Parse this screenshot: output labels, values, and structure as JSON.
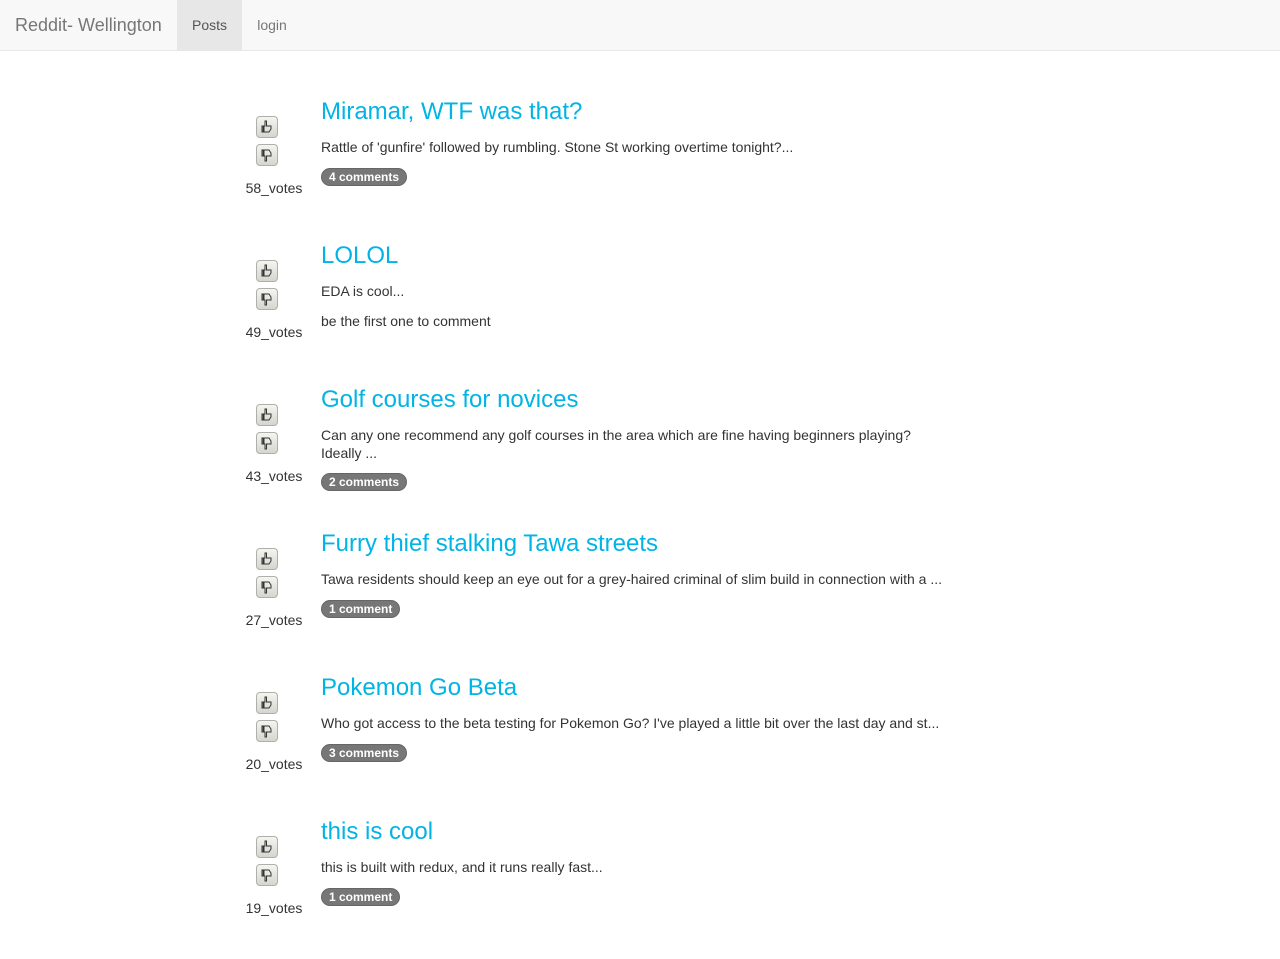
{
  "nav": {
    "brand": "Reddit- Wellington",
    "items": [
      {
        "label": "Posts",
        "active": true
      },
      {
        "label": "login",
        "active": false
      }
    ]
  },
  "icons": {
    "upvote": "thumbs-up-icon",
    "downvote": "thumbs-down-icon"
  },
  "colors": {
    "title_link": "#00b4e4",
    "badge": "#777777",
    "navbar_bg": "#f8f8f8"
  },
  "posts": [
    {
      "title": "Miramar, WTF was that?",
      "body": "Rattle of 'gunfire' followed by rumbling. Stone St working overtime tonight?...",
      "votes": "58_votes",
      "comments": "4 comments",
      "has_comments": true
    },
    {
      "title": "LOLOL",
      "body": "EDA is cool...",
      "votes": "49_votes",
      "comments": "be the first one to comment",
      "has_comments": false
    },
    {
      "title": "Golf courses for novices",
      "body": "Can any one recommend any golf courses in the area which are fine having beginners playing? Ideally ...",
      "votes": "43_votes",
      "comments": "2 comments",
      "has_comments": true
    },
    {
      "title": "Furry thief stalking Tawa streets",
      "body": "Tawa residents should keep an eye out for a grey-haired criminal of slim build in connection with a ...",
      "votes": "27_votes",
      "comments": "1 comment",
      "has_comments": true
    },
    {
      "title": "Pokemon Go Beta",
      "body": "Who got access to the beta testing for Pokemon Go? I've played a little bit over the last day and st...",
      "votes": "20_votes",
      "comments": "3 comments",
      "has_comments": true
    },
    {
      "title": "this is cool",
      "body": "this is built with redux, and it runs really fast...",
      "votes": "19_votes",
      "comments": "1 comment",
      "has_comments": true
    }
  ]
}
